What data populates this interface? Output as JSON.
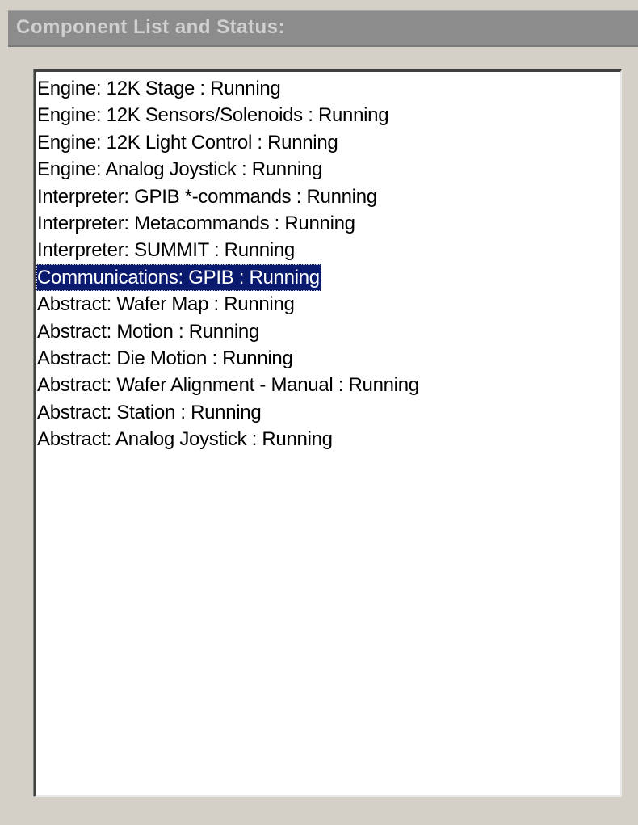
{
  "panel": {
    "title": "Component List and Status:"
  },
  "component_list": {
    "selected_index": 7,
    "items": [
      {
        "label": "Engine: 12K Stage : Running"
      },
      {
        "label": "Engine: 12K Sensors/Solenoids : Running"
      },
      {
        "label": "Engine: 12K Light Control : Running"
      },
      {
        "label": "Engine: Analog Joystick : Running"
      },
      {
        "label": "Interpreter: GPIB *-commands : Running"
      },
      {
        "label": "Interpreter: Metacommands : Running"
      },
      {
        "label": "Interpreter: SUMMIT : Running"
      },
      {
        "label": "Communications: GPIB : Running"
      },
      {
        "label": "Abstract: Wafer Map : Running"
      },
      {
        "label": "Abstract: Motion : Running"
      },
      {
        "label": "Abstract: Die Motion : Running"
      },
      {
        "label": "Abstract: Wafer Alignment - Manual : Running"
      },
      {
        "label": "Abstract: Station : Running"
      },
      {
        "label": "Abstract: Analog Joystick : Running"
      }
    ]
  },
  "colors": {
    "panel_background": "#d4d0c8",
    "title_bar_background": "#8c8c8c",
    "title_text": "#d0d0d0",
    "list_background": "#ffffff",
    "selection_background": "#0a1b6f",
    "selection_text": "#ffffff"
  }
}
